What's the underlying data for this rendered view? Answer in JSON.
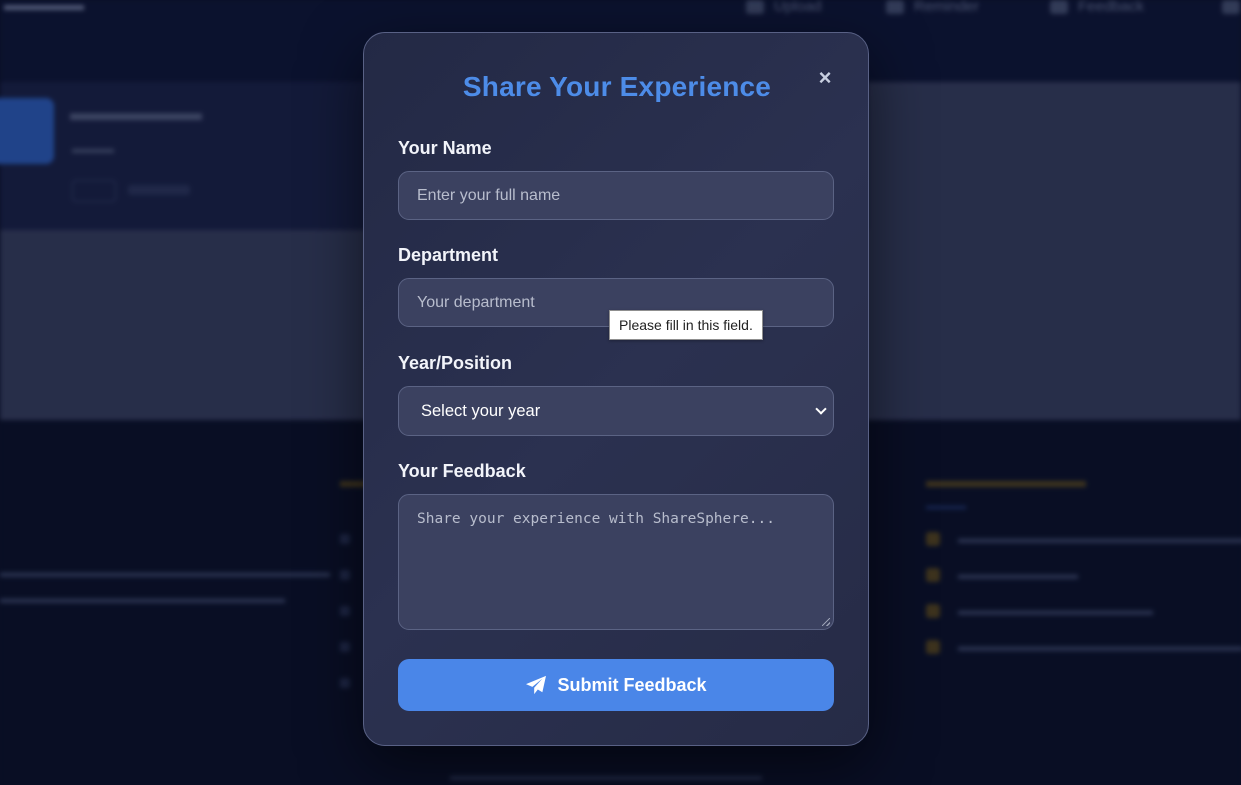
{
  "background": {
    "nav_items": [
      {
        "label": "Upload",
        "icon": "upload-icon"
      },
      {
        "label": "Reminder",
        "icon": "bell-icon"
      },
      {
        "label": "Feedback",
        "icon": "chat-icon"
      }
    ]
  },
  "modal": {
    "title": "Share Your Experience",
    "close_icon": "×",
    "name": {
      "label": "Your Name",
      "placeholder": "Enter your full name",
      "value": ""
    },
    "department": {
      "label": "Department",
      "placeholder": "Your department",
      "value": ""
    },
    "year": {
      "label": "Year/Position",
      "selected": "Select your year"
    },
    "feedback": {
      "label": "Your Feedback",
      "placeholder": "Share your experience with ShareSphere...",
      "value": ""
    },
    "submit": {
      "label": "Submit Feedback",
      "icon": "paper-plane-icon"
    },
    "tooltip": "Please fill in this field."
  },
  "colors": {
    "accent": "#4a86e8",
    "title": "#4d8ce8",
    "modal_bg": "#262b46",
    "page_bg": "#0b1229"
  }
}
